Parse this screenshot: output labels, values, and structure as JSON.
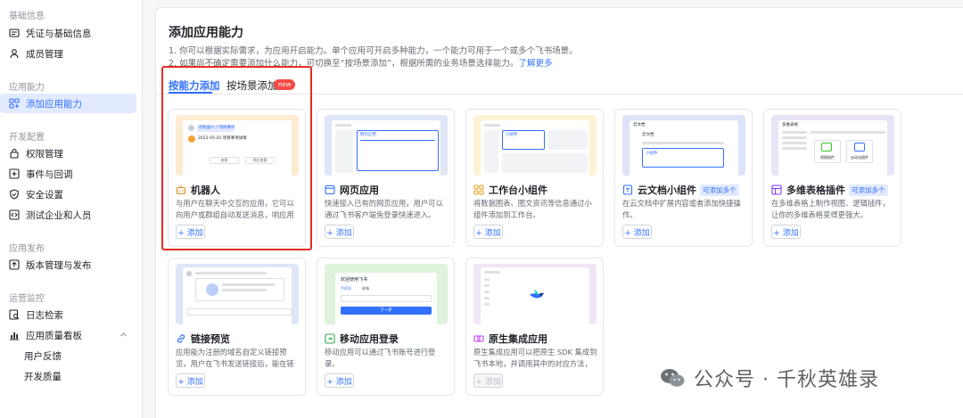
{
  "sidebar": {
    "sections": {
      "basic": "基础信息",
      "capability": "应用能力",
      "dev": "开发配置",
      "release": "应用发布",
      "ops": "运营监控"
    },
    "items": {
      "credentials": "凭证与基础信息",
      "members": "成员管理",
      "add_capability": "添加应用能力",
      "permissions": "权限管理",
      "events": "事件与回调",
      "security": "安全设置",
      "test": "测试企业和人员",
      "version": "版本管理与发布",
      "logs": "日志检索",
      "dashboard": "应用质量看板",
      "feedback": "用户反馈",
      "quality": "开发质量"
    }
  },
  "main": {
    "title": "添加应用能力",
    "desc1": "1. 你可以根据实际需求，为应用开启能力。单个应用可开启多种能力，一个能力可用于一个或多个飞书场景。",
    "desc2": "2. 如果尚不确定需要添加什么能力，可切换至“按场景添加”，根据所需的业务场景选择能力。",
    "learn_more": "了解更多",
    "tabs": {
      "by_capability": "按能力添加",
      "by_scenario": "按场景添加",
      "new_badge": "new"
    }
  },
  "cards": [
    {
      "title": "机器人",
      "desc": "与用户在聊天中交互的应用，它可以向用户或群组自动发送消息，响应用户的消...",
      "add": "+ 添加",
      "multi": ""
    },
    {
      "title": "网页应用",
      "desc": "快速接入已有的网页应用，用户可以通过飞书客户端免登录快速进入。",
      "add": "+ 添加",
      "multi": ""
    },
    {
      "title": "工作台小组件",
      "desc": "将数据图表、图文资讯等信息通过小组件添加到工作台。",
      "add": "+ 添加",
      "multi": ""
    },
    {
      "title": "云文档小组件",
      "desc": "在云文档中扩展内容或者添加快捷操作。",
      "add": "+ 添加",
      "multi": "可添加多个"
    },
    {
      "title": "多维表格插件",
      "desc": "在多维表格上制作视图、逻辑插件，让你的多维表格变得更强大。",
      "add": "+ 添加",
      "multi": "可添加多个"
    },
    {
      "title": "链接预览",
      "desc": "应用能为注册的域名自定义链接预览，用户在飞书发送链接后，能在链接下方展示...",
      "add": "+ 添加",
      "multi": ""
    },
    {
      "title": "移动应用登录",
      "desc": "移动应用可以通过飞书账号进行登录。",
      "add": "+ 添加",
      "multi": ""
    },
    {
      "title": "原生集成应用",
      "desc": "原生集成应用可以把原生 SDK 集成到飞书本地，并调用其中的对应方法，为用户提...",
      "add": "+ 添加",
      "multi": ""
    }
  ],
  "thumbs": {
    "bot_tag": "你机器人 / 项目事项",
    "bot_date": "2022-05-10 项目事项详情",
    "bot_btn1": "查看",
    "bot_btn2": "稍后查看",
    "web_label": "网页应用",
    "widget_label": "小组件",
    "doc_title": "云文档",
    "doc_sub": "云文档",
    "doc_label": "小组件",
    "base_title": "多维表格",
    "base_a": "视图插件",
    "base_b": "自动化插件",
    "login_title": "欢迎使用飞书",
    "login_tab1": "手机号",
    "login_tab2": "邮箱",
    "login_btn": "下一步"
  },
  "watermark": "公众号 · 千秋英雄录",
  "colors": {
    "accent": "#3370ff",
    "highlight_box": "#e02e24",
    "new_badge": "#f54a45"
  }
}
